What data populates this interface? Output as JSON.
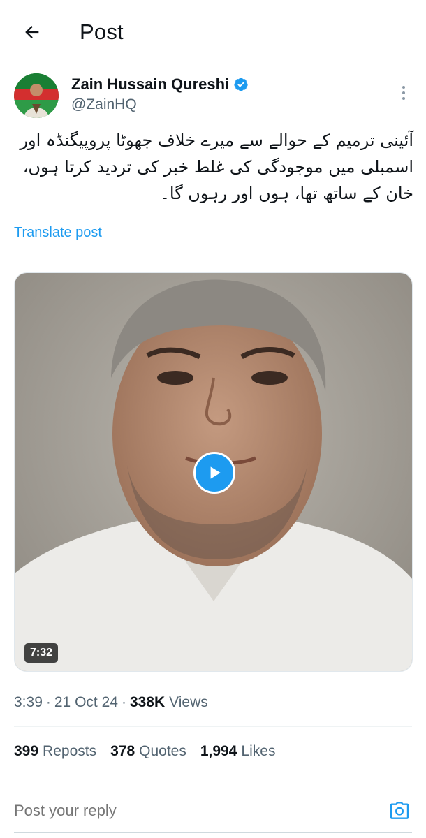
{
  "header": {
    "title": "Post",
    "back_icon": "arrow-left-icon"
  },
  "author": {
    "display_name": "Zain Hussain Qureshi",
    "handle": "@ZainHQ",
    "verified_icon": "verified-badge-icon",
    "verified_color": "#1d9bf0"
  },
  "post": {
    "text": "آئینی ترمیم کے حوالے سے میرے خلاف جھوٹا پروپیگنڈہ اور اسمبلی میں موجودگی کی غلط خبر کی تردید کرتا ہوں، خان کے ساتھ تھا، ہوں اور رہوں گا۔",
    "translate_label": "Translate post",
    "media": {
      "duration": "7:32",
      "play_icon": "play-icon"
    },
    "time": "3:39",
    "date": "21 Oct 24",
    "views_count": "338K",
    "views_label": "Views"
  },
  "stats": {
    "reposts_count": "399",
    "reposts_label": "Reposts",
    "quotes_count": "378",
    "quotes_label": "Quotes",
    "likes_count": "1,994",
    "likes_label": "Likes"
  },
  "reply": {
    "placeholder": "Post your reply",
    "camera_icon": "camera-icon"
  },
  "colors": {
    "accent": "#1d9bf0",
    "text_primary": "#0f1419",
    "text_secondary": "#536471"
  }
}
